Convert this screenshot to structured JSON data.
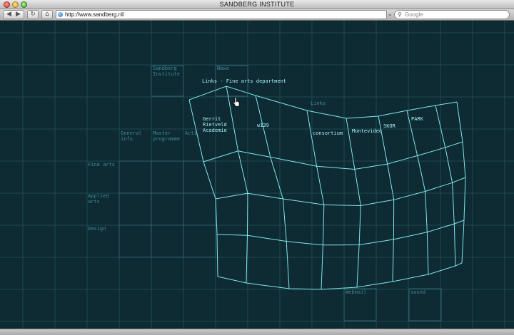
{
  "window": {
    "title": "SANDBERG INSTITUTE"
  },
  "toolbar": {
    "back_glyph": "◀",
    "forward_glyph": "▶",
    "reload_glyph": "↻",
    "home_glyph": "⌂",
    "address": "http://www.sandberg.nl/",
    "search_placeholder": "Google",
    "search_icon": "magnifier"
  },
  "page": {
    "labels": {
      "sandberg": [
        "Sandberg",
        "Institute"
      ],
      "news": "News",
      "breadcrumb": "Links - Fine arts department",
      "links_heading": "Links",
      "general": [
        "General",
        "info"
      ],
      "master": [
        "Master",
        "programme"
      ],
      "act": "Acti",
      "fine_arts": "Fine arts",
      "applied": [
        "Applied",
        "arts"
      ],
      "design": "Design",
      "webmail": "Webmail",
      "sound": "sound"
    },
    "links": {
      "rietveld": [
        "Gerrit",
        "Rietveld",
        "Academie"
      ],
      "w139": "w139",
      "consortium": "consortium",
      "montevideo": "Montevideo",
      "skor": "SKOR",
      "park": "PARK"
    }
  },
  "colors": {
    "background": "#0e2a33",
    "grid": "#1f4852",
    "box": "#2d6370",
    "dim_text": "#3f8d97",
    "mesh": "#7fe6ee",
    "bright_text": "#a8f3f6"
  }
}
